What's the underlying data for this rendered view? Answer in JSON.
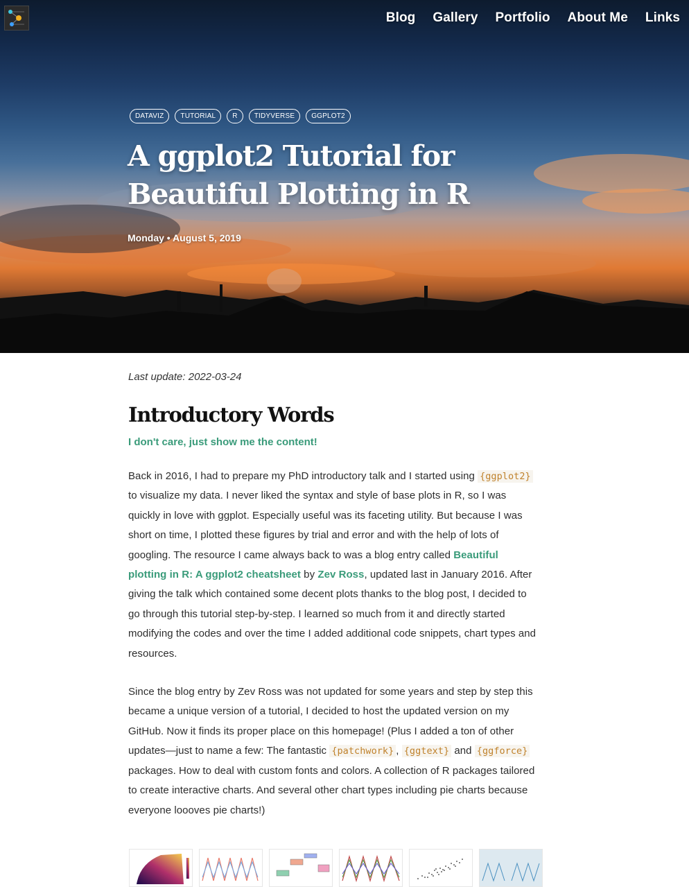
{
  "header": {
    "logo": "network-logo-icon",
    "nav": [
      "Blog",
      "Gallery",
      "Portfolio",
      "About Me",
      "Links"
    ]
  },
  "hero": {
    "tags": [
      "DATAVIZ",
      "TUTORIAL",
      "R",
      "TIDYVERSE",
      "GGPLOT2"
    ],
    "title": "A ggplot2 Tutorial for Beautiful Plotting in R",
    "date": "Monday • August 5, 2019"
  },
  "content": {
    "last_update": "Last update: 2022-03-24",
    "section_title": "Introductory Words",
    "skip_link": "I don't care, just show me the content!",
    "p1": {
      "t1": "Back in 2016, I had to prepare my PhD introductory talk and I started using ",
      "code1": "{ggplot2}",
      "t2": " to visualize my data. I never liked the syntax and style of base plots in R, so I was quickly in love with ggplot. Especially useful was its faceting utility. But because I was short on time, I plotted these figures by trial and error and with the help of lots of googling. The resource I came always back to was a blog entry called ",
      "link1": "Beautiful plotting in R: A ggplot2 cheatsheet",
      "t3": " by ",
      "link2": "Zev Ross",
      "t4": ", updated last in January 2016. After giving the talk which contained some decent plots thanks to the blog post, I decided to go through this tutorial step-by-step. I learned so much from it and directly started modifying the codes and over the time I added additional code snippets, chart types and resources."
    },
    "p2": {
      "t1": "Since the blog entry by Zev Ross was not updated for some years and step by step this became a unique version of a tutorial, I decided to host the updated version on my GitHub. Now it finds its proper place on this homepage! (Plus I added a ton of other updates—just to name a few: The fantastic ",
      "code1": "{patchwork}",
      "t2": ", ",
      "code2": "{ggtext}",
      "t3": " and ",
      "code3": "{ggforce}",
      "t4": " packages. How to deal with custom fonts and colors. A collection of R packages tailored to create interactive charts. And several other chart types including pie charts because everyone loooves pie charts!)"
    },
    "thumbnails": [
      "heatmap-plot",
      "line-plot",
      "boxplot",
      "multi-line-plot",
      "scatter-plot",
      "faceted-plot"
    ]
  },
  "colors": {
    "accent": "#3a9b7a",
    "code": "#c0822c"
  }
}
